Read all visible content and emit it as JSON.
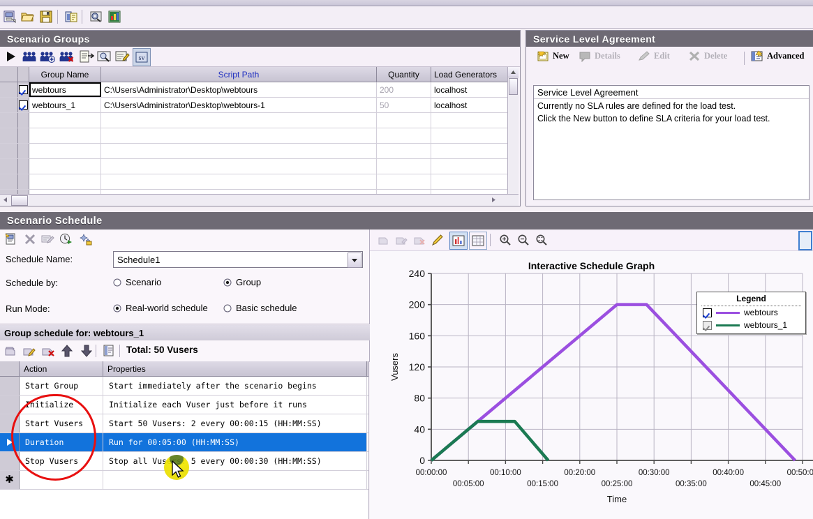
{
  "main_toolbar": {
    "buttons": [
      {
        "name": "new-scenario-icon",
        "label": "New"
      },
      {
        "name": "open-scenario-icon",
        "label": "Open"
      },
      {
        "name": "save-scenario-icon",
        "label": "Save"
      },
      {
        "name": "run-report-icon",
        "label": "Reports"
      },
      {
        "name": "results-settings-icon",
        "label": "Results Settings"
      },
      {
        "name": "analysis-icon",
        "label": "Analysis"
      }
    ]
  },
  "scenario_groups": {
    "title": "Scenario Groups",
    "toolbar": [
      {
        "name": "run-scenario-icon",
        "label": "Start Scenario"
      },
      {
        "name": "vusers-icon",
        "label": "Vusers"
      },
      {
        "name": "add-vusers-icon",
        "label": "Add Vusers"
      },
      {
        "name": "delete-vusers-icon",
        "label": "Delete Vusers"
      },
      {
        "name": "group-details-icon",
        "label": "Details"
      },
      {
        "name": "view-script-icon",
        "label": "View Script"
      },
      {
        "name": "edit-script-icon",
        "label": "Edit Script"
      },
      {
        "name": "generate-script-icon",
        "label": "Script"
      }
    ],
    "columns": [
      "Group Name",
      "Script Path",
      "Quantity",
      "Load Generators"
    ],
    "rows": [
      {
        "checked": true,
        "group_name": "webtours",
        "script_path": "C:\\Users\\Administrator\\Desktop\\webtours",
        "quantity": "200",
        "load_generators": "localhost"
      },
      {
        "checked": true,
        "group_name": "webtours_1",
        "script_path": "C:\\Users\\Administrator\\Desktop\\webtours-1",
        "quantity": "50",
        "load_generators": "localhost"
      }
    ],
    "empty_rows": 6
  },
  "sla": {
    "title": "Service Level Agreement",
    "toolbar": [
      {
        "name": "sla-new-button",
        "label": "New",
        "enabled": true
      },
      {
        "name": "sla-details-button",
        "label": "Details",
        "enabled": false
      },
      {
        "name": "sla-edit-button",
        "label": "Edit",
        "enabled": false
      },
      {
        "name": "sla-delete-button",
        "label": "Delete",
        "enabled": false
      },
      {
        "name": "sla-advanced-button",
        "label": "Advanced",
        "enabled": true
      }
    ],
    "pane_header": "Service Level Agreement",
    "pane_lines": [
      "Currently no SLA rules are defined for the load test.",
      "Click the New button to define SLA criteria for your load test."
    ]
  },
  "scenario_schedule": {
    "title": "Scenario Schedule",
    "toolbar": [
      {
        "name": "new-schedule-icon",
        "label": "New Schedule"
      },
      {
        "name": "delete-schedule-icon",
        "label": "Delete Schedule"
      },
      {
        "name": "rename-schedule-icon",
        "label": "Rename Schedule"
      },
      {
        "name": "schedule-run-icon",
        "label": "Run"
      },
      {
        "name": "schedule-wizard-icon",
        "label": "Schedule Wizard"
      }
    ],
    "schedule_name_label": "Schedule Name:",
    "schedule_name_value": "Schedule1",
    "schedule_by_label": "Schedule by:",
    "schedule_by_options": [
      {
        "label": "Scenario",
        "selected": false
      },
      {
        "label": "Group",
        "selected": true
      }
    ],
    "run_mode_label": "Run Mode:",
    "run_mode_options": [
      {
        "label": "Real-world schedule",
        "selected": true
      },
      {
        "label": "Basic schedule",
        "selected": false
      }
    ]
  },
  "group_schedule": {
    "header": "Group schedule for: webtours_1",
    "toolbar": [
      {
        "name": "add-action-icon",
        "label": "Add Action"
      },
      {
        "name": "edit-action-icon",
        "label": "Edit Action"
      },
      {
        "name": "delete-action-icon",
        "label": "Delete Action"
      },
      {
        "name": "move-up-icon",
        "label": "Move Up"
      },
      {
        "name": "move-down-icon",
        "label": "Move Down"
      },
      {
        "name": "schedule-grid-icon",
        "label": "Grid"
      }
    ],
    "total_label": "Total: 50 Vusers",
    "columns": [
      "Action",
      "Properties"
    ],
    "rows": [
      {
        "action": "Start Group",
        "properties": "Start immediately after the scenario begins",
        "selected": false,
        "current": false
      },
      {
        "action": "Initialize",
        "properties": "Initialize each Vuser just before it runs",
        "selected": false,
        "current": false
      },
      {
        "action": "Start  Vusers",
        "properties": "Start 50 Vusers: 2 every 00:00:15 (HH:MM:SS)",
        "selected": false,
        "current": false
      },
      {
        "action": "Duration",
        "properties": "Run for 00:05:00 (HH:MM:SS)",
        "selected": true,
        "current": true
      },
      {
        "action": "Stop Vusers",
        "properties": "Stop all Vusers: 5 every 00:00:30 (HH:MM:SS)",
        "selected": false,
        "current": false
      },
      {
        "action": "",
        "properties": "",
        "selected": false,
        "current": false,
        "new_row": true
      }
    ]
  },
  "graph_panel": {
    "toolbar": [
      {
        "name": "graph-add-icon",
        "label": "Add",
        "enabled": false
      },
      {
        "name": "graph-edit-point-icon",
        "label": "Edit Point",
        "enabled": false
      },
      {
        "name": "graph-delete-point-icon",
        "label": "Delete Point",
        "enabled": false
      },
      {
        "name": "graph-pencil-icon",
        "label": "Edit",
        "enabled": true
      },
      {
        "name": "graph-chart-icon",
        "label": "Chart View",
        "enabled": true,
        "active": true
      },
      {
        "name": "graph-grid-icon",
        "label": "Grid View",
        "enabled": true
      },
      {
        "name": "zoom-in-icon",
        "label": "Zoom In",
        "enabled": true
      },
      {
        "name": "zoom-out-icon",
        "label": "Zoom Out",
        "enabled": true
      },
      {
        "name": "zoom-fit-icon",
        "label": "Fit to Window",
        "enabled": true
      }
    ]
  },
  "chart_data": {
    "type": "line",
    "title": "Interactive Schedule Graph",
    "xlabel": "Time",
    "ylabel": "Vusers",
    "ylim": [
      0,
      240
    ],
    "yticks": [
      0,
      40,
      80,
      120,
      160,
      200,
      240
    ],
    "xlim_seconds": [
      0,
      3000
    ],
    "xticks": [
      "00:00:00",
      "00:05:00",
      "00:10:00",
      "00:15:00",
      "00:20:00",
      "00:25:00",
      "00:30:00",
      "00:35:00",
      "00:40:00",
      "00:45:00",
      "00:50:00"
    ],
    "grid": true,
    "legend": {
      "title": "Legend",
      "position": "top-right",
      "entries": [
        {
          "name": "webtours",
          "color": "#9b4fe0",
          "checked": true,
          "enabled": true
        },
        {
          "name": "webtours_1",
          "color": "#1b7a52",
          "checked": true,
          "enabled": false
        }
      ]
    },
    "series": [
      {
        "name": "webtours",
        "color": "#9b4fe0",
        "points": [
          {
            "t": "00:00:00",
            "seconds": 0,
            "vusers": 0
          },
          {
            "t": "00:25:00",
            "seconds": 1500,
            "vusers": 200
          },
          {
            "t": "00:29:00",
            "seconds": 1740,
            "vusers": 200
          },
          {
            "t": "00:49:00",
            "seconds": 2940,
            "vusers": 0
          }
        ]
      },
      {
        "name": "webtours_1",
        "color": "#1b7a52",
        "points": [
          {
            "t": "00:00:00",
            "seconds": 0,
            "vusers": 0
          },
          {
            "t": "00:06:15",
            "seconds": 375,
            "vusers": 50
          },
          {
            "t": "00:11:15",
            "seconds": 675,
            "vusers": 50
          },
          {
            "t": "00:15:45",
            "seconds": 945,
            "vusers": 0
          }
        ]
      }
    ]
  },
  "colors": {
    "webtours": "#9b4fe0",
    "webtours_1": "#1b7a52",
    "selection": "#1273dc",
    "annotation": "#e81010",
    "panel_title_bg": "#6e6a74"
  }
}
